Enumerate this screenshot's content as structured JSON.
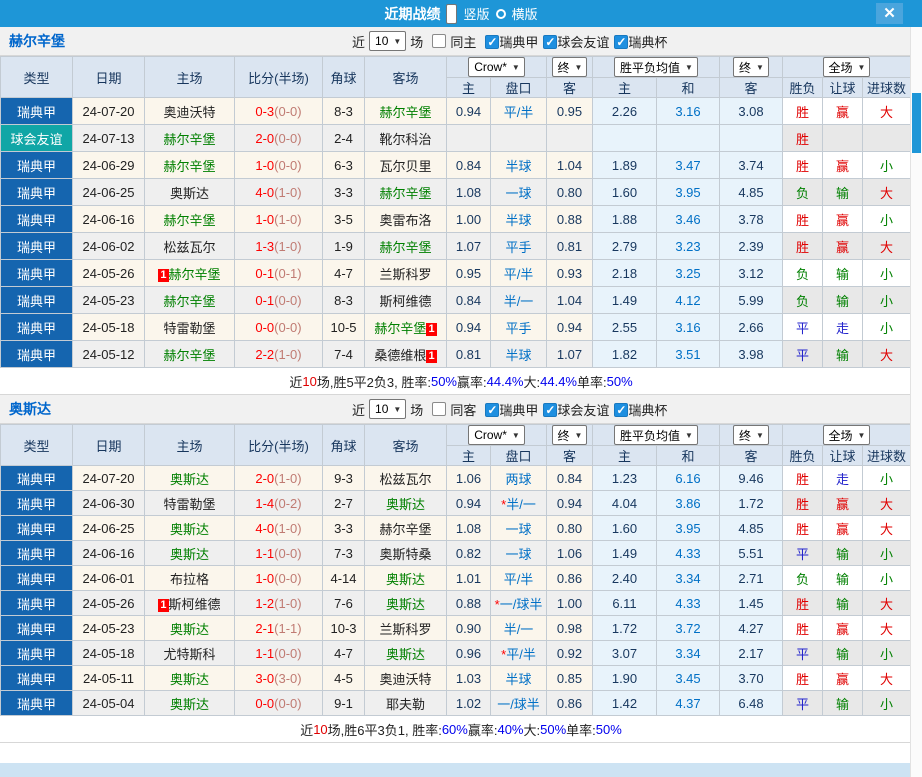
{
  "titlebar": {
    "title": "近期战绩",
    "radios": [
      {
        "label": "竖版",
        "selected": true
      },
      {
        "label": "横版",
        "selected": false
      }
    ],
    "close_label": "✕"
  },
  "colors": {
    "titlebar": "#1e96d7",
    "close_bg": "#4aa5dd",
    "scroll_thumb": "#1e96d7",
    "bottom_strip": "#cde3f3",
    "badge": {
      "瑞典甲": "#1565af",
      "球会友谊": "#10a6a6"
    },
    "result_map": {
      "胜": "#e00000",
      "负": "#008000",
      "平": "#2222cc",
      "赢": "#e00000",
      "输": "#008000",
      "走": "#2222cc",
      "大": "#e00000",
      "小": "#008000"
    }
  },
  "columns": {
    "type": "类型",
    "date": "日期",
    "home": "主场",
    "score": "比分(半场)",
    "corner": "角球",
    "away": "客场",
    "crow_select": "Crow*",
    "final_select": "终",
    "odds_home": "主",
    "odds_hcp": "盘口",
    "odds_away": "客",
    "avg_select": "胜平负均值",
    "avg_final_select": "终",
    "avg_home": "主",
    "avg_draw": "和",
    "avg_away": "客",
    "fulltime_select": "全场",
    "wdl": "胜负",
    "hcp_result": "让球",
    "goals": "进球数"
  },
  "sections": [
    {
      "team": "赫尔辛堡",
      "filters": {
        "near_label": "近",
        "count": "10",
        "games_label": "场",
        "same_label": "同主",
        "same_checked": false,
        "leagues": [
          {
            "label": "瑞典甲",
            "checked": true
          },
          {
            "label": "球会友谊",
            "checked": true
          },
          {
            "label": "瑞典杯",
            "checked": true
          }
        ]
      },
      "rows": [
        {
          "lg": "瑞典甲",
          "d": "24-07-20",
          "h": "奥迪沃特",
          "hf": 0,
          "hc": "",
          "s": "0-3",
          "hs": "(0-0)",
          "cn": "8-3",
          "a": "赫尔辛堡",
          "af": 1,
          "ac": "",
          "o1": "0.94",
          "hp": "平/半",
          "o2": "0.95",
          "a1": "2.26",
          "a2": "3.16",
          "a3": "3.08",
          "r1": "胜",
          "r2": "赢",
          "r3": "大"
        },
        {
          "lg": "球会友谊",
          "d": "24-07-13",
          "h": "赫尔辛堡",
          "hf": 1,
          "hc": "",
          "s": "2-0",
          "hs": "(0-0)",
          "cn": "2-4",
          "a": "靴尔科治",
          "af": 0,
          "ac": "",
          "o1": "",
          "hp": "",
          "o2": "",
          "a1": "",
          "a2": "",
          "a3": "",
          "r1": "胜",
          "r2": "",
          "r3": ""
        },
        {
          "lg": "瑞典甲",
          "d": "24-06-29",
          "h": "赫尔辛堡",
          "hf": 1,
          "hc": "",
          "s": "1-0",
          "hs": "(0-0)",
          "cn": "6-3",
          "a": "瓦尔贝里",
          "af": 0,
          "ac": "",
          "o1": "0.84",
          "hp": "半球",
          "o2": "1.04",
          "a1": "1.89",
          "a2": "3.47",
          "a3": "3.74",
          "r1": "胜",
          "r2": "赢",
          "r3": "小"
        },
        {
          "lg": "瑞典甲",
          "d": "24-06-25",
          "h": "奥斯达",
          "hf": 0,
          "hc": "",
          "s": "4-0",
          "hs": "(1-0)",
          "cn": "3-3",
          "a": "赫尔辛堡",
          "af": 1,
          "ac": "",
          "o1": "1.08",
          "hp": "一球",
          "o2": "0.80",
          "a1": "1.60",
          "a2": "3.95",
          "a3": "4.85",
          "r1": "负",
          "r2": "输",
          "r3": "大"
        },
        {
          "lg": "瑞典甲",
          "d": "24-06-16",
          "h": "赫尔辛堡",
          "hf": 1,
          "hc": "",
          "s": "1-0",
          "hs": "(1-0)",
          "cn": "3-5",
          "a": "奥雷布洛",
          "af": 0,
          "ac": "",
          "o1": "1.00",
          "hp": "半球",
          "o2": "0.88",
          "a1": "1.88",
          "a2": "3.46",
          "a3": "3.78",
          "r1": "胜",
          "r2": "赢",
          "r3": "小"
        },
        {
          "lg": "瑞典甲",
          "d": "24-06-02",
          "h": "松兹瓦尔",
          "hf": 0,
          "hc": "",
          "s": "1-3",
          "hs": "(1-0)",
          "cn": "1-9",
          "a": "赫尔辛堡",
          "af": 1,
          "ac": "",
          "o1": "1.07",
          "hp": "平手",
          "o2": "0.81",
          "a1": "2.79",
          "a2": "3.23",
          "a3": "2.39",
          "r1": "胜",
          "r2": "赢",
          "r3": "大"
        },
        {
          "lg": "瑞典甲",
          "d": "24-05-26",
          "h": "赫尔辛堡",
          "hf": 1,
          "hc": "1",
          "s": "0-1",
          "hs": "(0-1)",
          "cn": "4-7",
          "a": "兰斯科罗",
          "af": 0,
          "ac": "",
          "o1": "0.95",
          "hp": "平/半",
          "o2": "0.93",
          "a1": "2.18",
          "a2": "3.25",
          "a3": "3.12",
          "r1": "负",
          "r2": "输",
          "r3": "小"
        },
        {
          "lg": "瑞典甲",
          "d": "24-05-23",
          "h": "赫尔辛堡",
          "hf": 1,
          "hc": "",
          "s": "0-1",
          "hs": "(0-0)",
          "cn": "8-3",
          "a": "斯柯维德",
          "af": 0,
          "ac": "",
          "o1": "0.84",
          "hp": "半/一",
          "o2": "1.04",
          "a1": "1.49",
          "a2": "4.12",
          "a3": "5.99",
          "r1": "负",
          "r2": "输",
          "r3": "小"
        },
        {
          "lg": "瑞典甲",
          "d": "24-05-18",
          "h": "特雷勒堡",
          "hf": 0,
          "hc": "",
          "s": "0-0",
          "hs": "(0-0)",
          "cn": "10-5",
          "a": "赫尔辛堡",
          "af": 1,
          "ac": "1",
          "o1": "0.94",
          "hp": "平手",
          "o2": "0.94",
          "a1": "2.55",
          "a2": "3.16",
          "a3": "2.66",
          "r1": "平",
          "r2": "走",
          "r3": "小"
        },
        {
          "lg": "瑞典甲",
          "d": "24-05-12",
          "h": "赫尔辛堡",
          "hf": 1,
          "hc": "",
          "s": "2-2",
          "hs": "(1-0)",
          "cn": "7-4",
          "a": "桑德维根",
          "af": 0,
          "ac": "1",
          "o1": "0.81",
          "hp": "半球",
          "o2": "1.07",
          "a1": "1.82",
          "a2": "3.51",
          "a3": "3.98",
          "r1": "平",
          "r2": "输",
          "r3": "大"
        }
      ],
      "summary": [
        [
          "近",
          "k"
        ],
        [
          "10",
          "r"
        ],
        [
          "场,胜5平2负3, 胜率:",
          "k"
        ],
        [
          "50%",
          "b"
        ],
        [
          " 赢率:",
          "k"
        ],
        [
          "44.4%",
          "b"
        ],
        [
          " 大:",
          "k"
        ],
        [
          "44.4%",
          "b"
        ],
        [
          " 单率:",
          "k"
        ],
        [
          "50%",
          "b"
        ]
      ]
    },
    {
      "team": "奥斯达",
      "filters": {
        "near_label": "近",
        "count": "10",
        "games_label": "场",
        "same_label": "同客",
        "same_checked": false,
        "leagues": [
          {
            "label": "瑞典甲",
            "checked": true
          },
          {
            "label": "球会友谊",
            "checked": true
          },
          {
            "label": "瑞典杯",
            "checked": true
          }
        ]
      },
      "rows": [
        {
          "lg": "瑞典甲",
          "d": "24-07-20",
          "h": "奥斯达",
          "hf": 1,
          "hc": "",
          "s": "2-0",
          "hs": "(1-0)",
          "cn": "9-3",
          "a": "松兹瓦尔",
          "af": 0,
          "ac": "",
          "o1": "1.06",
          "hp": "两球",
          "o2": "0.84",
          "a1": "1.23",
          "a2": "6.16",
          "a3": "9.46",
          "r1": "胜",
          "r2": "走",
          "r3": "小"
        },
        {
          "lg": "瑞典甲",
          "d": "24-06-30",
          "h": "特雷勒堡",
          "hf": 0,
          "hc": "",
          "s": "1-4",
          "hs": "(0-2)",
          "cn": "2-7",
          "a": "奥斯达",
          "af": 1,
          "ac": "",
          "o1": "0.94",
          "hp": "*半/一",
          "o2": "0.94",
          "a1": "4.04",
          "a2": "3.86",
          "a3": "1.72",
          "r1": "胜",
          "r2": "赢",
          "r3": "大"
        },
        {
          "lg": "瑞典甲",
          "d": "24-06-25",
          "h": "奥斯达",
          "hf": 1,
          "hc": "",
          "s": "4-0",
          "hs": "(1-0)",
          "cn": "3-3",
          "a": "赫尔辛堡",
          "af": 0,
          "ac": "",
          "o1": "1.08",
          "hp": "一球",
          "o2": "0.80",
          "a1": "1.60",
          "a2": "3.95",
          "a3": "4.85",
          "r1": "胜",
          "r2": "赢",
          "r3": "大"
        },
        {
          "lg": "瑞典甲",
          "d": "24-06-16",
          "h": "奥斯达",
          "hf": 1,
          "hc": "",
          "s": "1-1",
          "hs": "(0-0)",
          "cn": "7-3",
          "a": "奥斯特桑",
          "af": 0,
          "ac": "",
          "o1": "0.82",
          "hp": "一球",
          "o2": "1.06",
          "a1": "1.49",
          "a2": "4.33",
          "a3": "5.51",
          "r1": "平",
          "r2": "输",
          "r3": "小"
        },
        {
          "lg": "瑞典甲",
          "d": "24-06-01",
          "h": "布拉格",
          "hf": 0,
          "hc": "",
          "s": "1-0",
          "hs": "(0-0)",
          "cn": "4-14",
          "a": "奥斯达",
          "af": 1,
          "ac": "",
          "o1": "1.01",
          "hp": "平/半",
          "o2": "0.86",
          "a1": "2.40",
          "a2": "3.34",
          "a3": "2.71",
          "r1": "负",
          "r2": "输",
          "r3": "小"
        },
        {
          "lg": "瑞典甲",
          "d": "24-05-26",
          "h": "斯柯维德",
          "hf": 0,
          "hc": "1",
          "s": "1-2",
          "hs": "(1-0)",
          "cn": "7-6",
          "a": "奥斯达",
          "af": 1,
          "ac": "",
          "o1": "0.88",
          "hp": "*一/球半",
          "o2": "1.00",
          "a1": "6.11",
          "a2": "4.33",
          "a3": "1.45",
          "r1": "胜",
          "r2": "输",
          "r3": "大"
        },
        {
          "lg": "瑞典甲",
          "d": "24-05-23",
          "h": "奥斯达",
          "hf": 1,
          "hc": "",
          "s": "2-1",
          "hs": "(1-1)",
          "cn": "10-3",
          "a": "兰斯科罗",
          "af": 0,
          "ac": "",
          "o1": "0.90",
          "hp": "半/一",
          "o2": "0.98",
          "a1": "1.72",
          "a2": "3.72",
          "a3": "4.27",
          "r1": "胜",
          "r2": "赢",
          "r3": "大"
        },
        {
          "lg": "瑞典甲",
          "d": "24-05-18",
          "h": "尤特斯科",
          "hf": 0,
          "hc": "",
          "s": "1-1",
          "hs": "(0-0)",
          "cn": "4-7",
          "a": "奥斯达",
          "af": 1,
          "ac": "",
          "o1": "0.96",
          "hp": "*平/半",
          "o2": "0.92",
          "a1": "3.07",
          "a2": "3.34",
          "a3": "2.17",
          "r1": "平",
          "r2": "输",
          "r3": "小"
        },
        {
          "lg": "瑞典甲",
          "d": "24-05-11",
          "h": "奥斯达",
          "hf": 1,
          "hc": "",
          "s": "3-0",
          "hs": "(3-0)",
          "cn": "4-5",
          "a": "奥迪沃特",
          "af": 0,
          "ac": "",
          "o1": "1.03",
          "hp": "半球",
          "o2": "0.85",
          "a1": "1.90",
          "a2": "3.45",
          "a3": "3.70",
          "r1": "胜",
          "r2": "赢",
          "r3": "大"
        },
        {
          "lg": "瑞典甲",
          "d": "24-05-04",
          "h": "奥斯达",
          "hf": 1,
          "hc": "",
          "s": "0-0",
          "hs": "(0-0)",
          "cn": "9-1",
          "a": "耶夫勒",
          "af": 0,
          "ac": "",
          "o1": "1.02",
          "hp": "一/球半",
          "o2": "0.86",
          "a1": "1.42",
          "a2": "4.37",
          "a3": "6.48",
          "r1": "平",
          "r2": "输",
          "r3": "小"
        }
      ],
      "summary": [
        [
          "近",
          "k"
        ],
        [
          "10",
          "r"
        ],
        [
          "场,胜6平3负1, 胜率:",
          "k"
        ],
        [
          "60%",
          "b"
        ],
        [
          " 赢率:",
          "k"
        ],
        [
          "40%",
          "b"
        ],
        [
          " 大:",
          "k"
        ],
        [
          "50%",
          "b"
        ],
        [
          " 单率:",
          "k"
        ],
        [
          "50%",
          "b"
        ]
      ]
    }
  ]
}
